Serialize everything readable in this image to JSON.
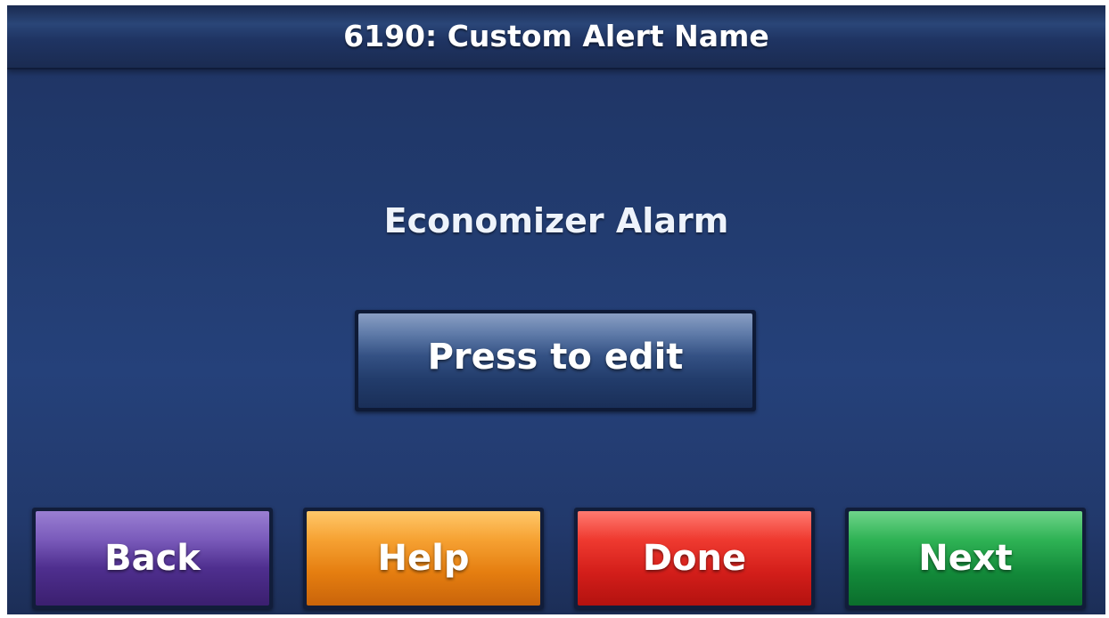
{
  "header": {
    "title": "6190: Custom Alert Name"
  },
  "main": {
    "alert_name": "Economizer Alarm",
    "edit_button_label": "Press to edit"
  },
  "footer": {
    "buttons": [
      {
        "label": "Back",
        "color": "#5b3a9e"
      },
      {
        "label": "Help",
        "color": "#f39a2a"
      },
      {
        "label": "Done",
        "color": "#e02a22"
      },
      {
        "label": "Next",
        "color": "#1ea04a"
      }
    ]
  },
  "colors": {
    "screen_background": "#223a6c",
    "header_background": "#1f3463",
    "text": "#ffffff"
  }
}
